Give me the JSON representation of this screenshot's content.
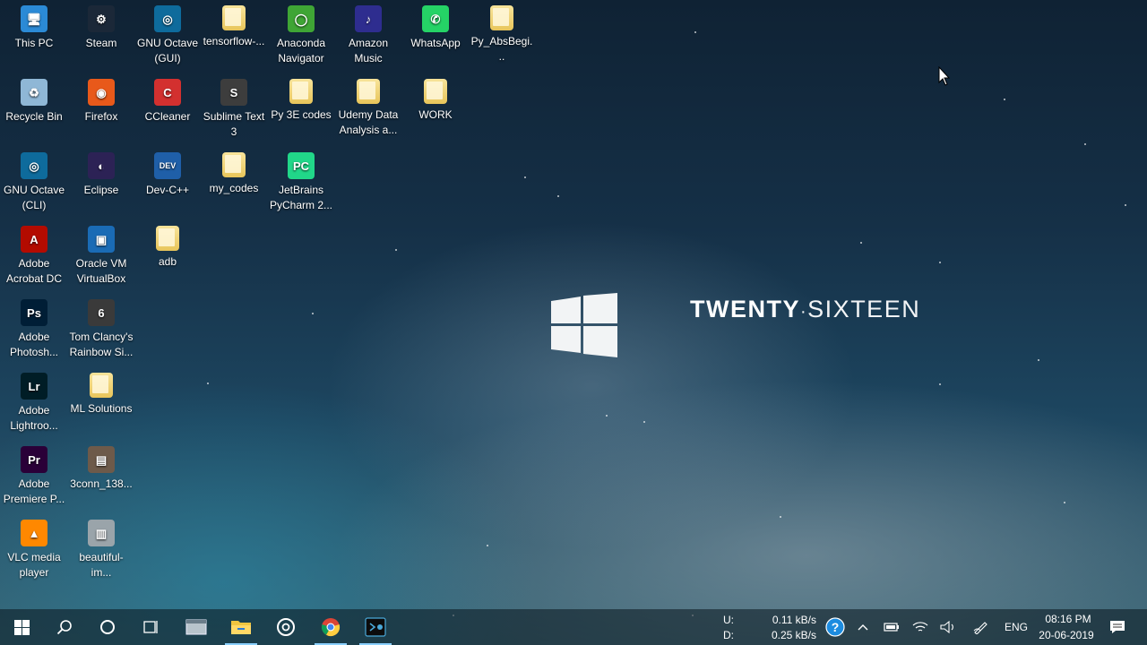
{
  "brand": {
    "bold": "TWENTY",
    "light": "SIXTEEN"
  },
  "desktop_icons": [
    {
      "label": "This PC",
      "icon": "this-pc-icon",
      "color": "#2b8ad6",
      "glyph": "🖥"
    },
    {
      "label": "Steam",
      "icon": "steam-icon",
      "color": "#1b2838",
      "glyph": "⚙"
    },
    {
      "label": "GNU Octave (GUI)",
      "icon": "octave-icon",
      "color": "#0e6b9c",
      "glyph": "◎"
    },
    {
      "label": "tensorflow-...",
      "icon": "folder-icon",
      "color": "",
      "glyph": ""
    },
    {
      "label": "Anaconda Navigator",
      "icon": "anaconda-icon",
      "color": "#3fa535",
      "glyph": "◯"
    },
    {
      "label": "Amazon Music",
      "icon": "amazon-music-icon",
      "color": "#2e2d8f",
      "glyph": "♪"
    },
    {
      "label": "WhatsApp",
      "icon": "whatsapp-icon",
      "color": "#25d366",
      "glyph": "✆"
    },
    {
      "label": "Py_AbsBegi...",
      "icon": "folder-icon",
      "color": "",
      "glyph": ""
    },
    {
      "label": "Recycle Bin",
      "icon": "recycle-bin-icon",
      "color": "#8fb7d6",
      "glyph": "♻"
    },
    {
      "label": "Firefox",
      "icon": "firefox-icon",
      "color": "#e8591a",
      "glyph": "◉"
    },
    {
      "label": "CCleaner",
      "icon": "ccleaner-icon",
      "color": "#d3302f",
      "glyph": "C"
    },
    {
      "label": "Sublime Text 3",
      "icon": "sublime-text-icon",
      "color": "#3d3d3d",
      "glyph": "S"
    },
    {
      "label": "Py 3E codes",
      "icon": "folder-icon",
      "color": "",
      "glyph": ""
    },
    {
      "label": "Udemy Data Analysis a...",
      "icon": "folder-icon",
      "color": "",
      "glyph": ""
    },
    {
      "label": "WORK",
      "icon": "folder-icon",
      "color": "",
      "glyph": ""
    },
    {
      "label": "GNU Octave (CLI)",
      "icon": "octave-icon",
      "color": "#0e6b9c",
      "glyph": "◎"
    },
    {
      "label": "Eclipse",
      "icon": "eclipse-icon",
      "color": "#2c2255",
      "glyph": "◐"
    },
    {
      "label": "Dev-C++",
      "icon": "dev-cpp-icon",
      "color": "#1f5fa8",
      "glyph": "DEV"
    },
    {
      "label": "my_codes",
      "icon": "folder-icon",
      "color": "",
      "glyph": ""
    },
    {
      "label": "JetBrains PyCharm 2...",
      "icon": "pycharm-icon",
      "color": "#21d789",
      "glyph": "PC"
    },
    {
      "label": "Adobe Acrobat DC",
      "icon": "acrobat-icon",
      "color": "#b30b00",
      "glyph": "A"
    },
    {
      "label": "Oracle VM VirtualBox",
      "icon": "virtualbox-icon",
      "color": "#1a6bb5",
      "glyph": "▣"
    },
    {
      "label": "adb",
      "icon": "folder-icon",
      "color": "",
      "glyph": ""
    },
    {
      "label": "Adobe Photosh...",
      "icon": "photoshop-icon",
      "color": "#001e36",
      "glyph": "Ps"
    },
    {
      "label": "Tom Clancy's Rainbow Si...",
      "icon": "rainbow-six-icon",
      "color": "#3a3a3a",
      "glyph": "6"
    },
    {
      "label": "Adobe Lightroo...",
      "icon": "lightroom-icon",
      "color": "#001d26",
      "glyph": "Lr"
    },
    {
      "label": "ML Solutions",
      "icon": "folder-icon",
      "color": "",
      "glyph": ""
    },
    {
      "label": "Adobe Premiere P...",
      "icon": "premiere-icon",
      "color": "#2a0038",
      "glyph": "Pr"
    },
    {
      "label": "3conn_138...",
      "icon": "image-file-icon",
      "color": "#6d5a4a",
      "glyph": "▤"
    },
    {
      "label": "VLC media player",
      "icon": "vlc-icon",
      "color": "#ff8800",
      "glyph": "▲"
    },
    {
      "label": "beautiful-im...",
      "icon": "image-file-icon",
      "color": "#9aa4aa",
      "glyph": "▥"
    }
  ],
  "taskbar": {
    "upload_label": "U:",
    "download_label": "D:",
    "upload_speed": "0.11 kB/s",
    "download_speed": "0.25 kB/s",
    "language": "ENG",
    "time": "08:16 PM",
    "date": "20-06-2019",
    "accent_color": "#8ad0ff"
  }
}
